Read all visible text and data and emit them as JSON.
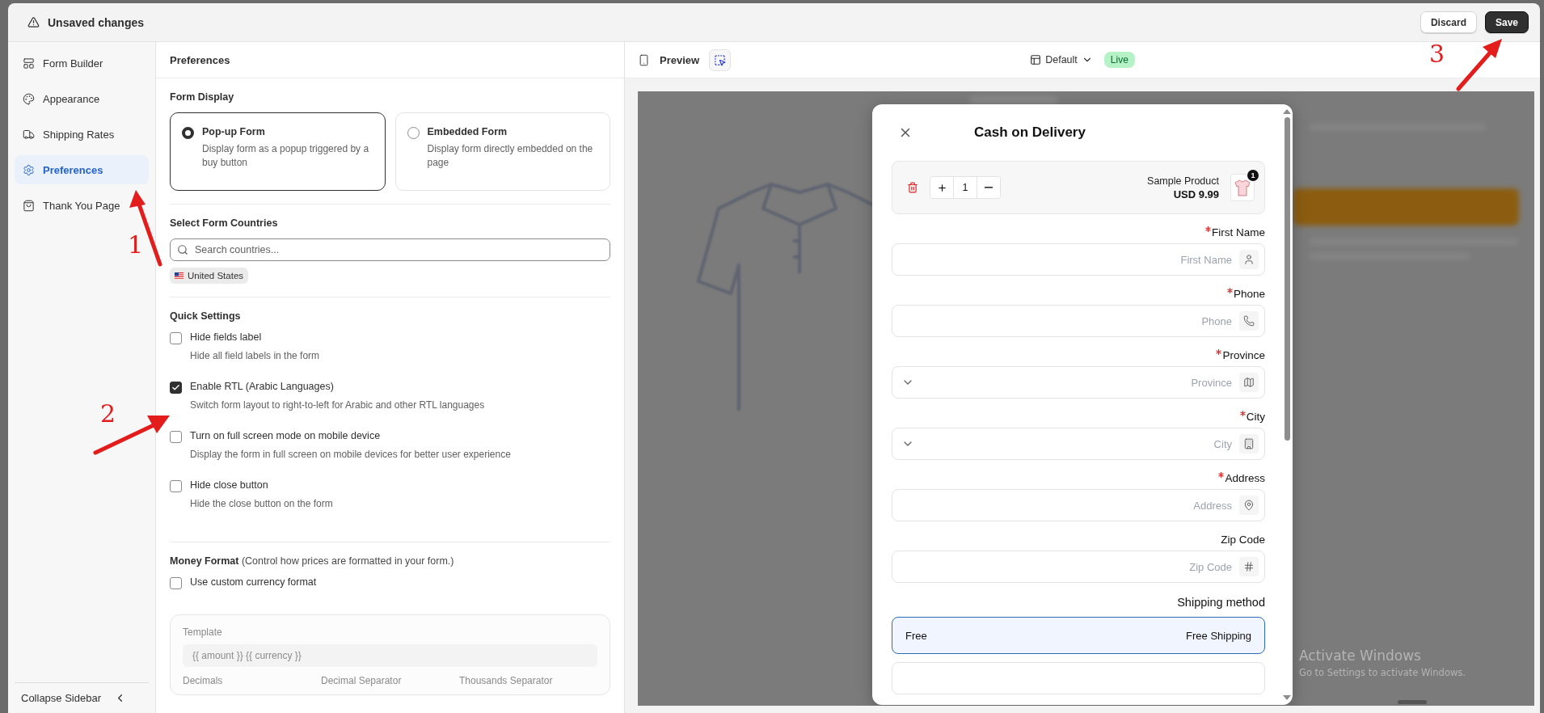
{
  "header": {
    "title": "Unsaved changes",
    "buttons": [
      {
        "label": "Discard",
        "kind": "secondary"
      },
      {
        "label": "Save",
        "kind": "primary"
      }
    ]
  },
  "sidebar": {
    "items": [
      {
        "label": "Form Builder",
        "selected": false
      },
      {
        "label": "Appearance",
        "selected": false
      },
      {
        "label": "Shipping Rates",
        "selected": false
      },
      {
        "label": "Preferences",
        "selected": true
      },
      {
        "label": "Thank You Page",
        "selected": false
      }
    ],
    "collapse_label": "Collapse Sidebar"
  },
  "settings": {
    "title": "Preferences",
    "form_display": {
      "heading": "Form Display",
      "options": [
        {
          "title": "Pop-up Form",
          "description": "Display form as a popup triggered by a buy button",
          "selected": true
        },
        {
          "title": "Embedded Form",
          "description": "Display form directly embedded on the page",
          "selected": false
        }
      ]
    },
    "countries": {
      "heading": "Select Form Countries",
      "search": {
        "placeholder": "Search countries..."
      },
      "chips": [
        {
          "label": "United States"
        }
      ]
    },
    "quick_settings": {
      "heading": "Quick Settings",
      "options": [
        {
          "label": "Hide fields label",
          "description": "Hide all field labels in the form",
          "checked": false
        },
        {
          "label": "Enable RTL (Arabic Languages)",
          "description": "Switch form layout to right-to-left for Arabic and other RTL languages",
          "checked": true
        },
        {
          "label": "Turn on full screen mode on mobile device",
          "description": "Display the form in full screen on mobile devices for better user experience",
          "checked": false
        },
        {
          "label": "Hide close button",
          "description": "Hide the close button on the form",
          "checked": false
        }
      ]
    },
    "money_format": {
      "heading": "**Money Format** (Control how prices are formatted in your form.)",
      "custom_format": {
        "label": "Use custom currency format",
        "checked": false
      },
      "template": {
        "label": "Template",
        "placeholder": "{{ amount }} {{ currency }}",
        "disabled": true
      },
      "columns": [
        "Decimals",
        "Decimal Separator",
        "Thousands Separator"
      ]
    }
  },
  "preview": {
    "title": "Preview",
    "theme": "Default",
    "status": "Live",
    "form": {
      "title": "Cash on Delivery",
      "product": {
        "name": "Sample Product",
        "price": "USD 9.99",
        "quantity": "1",
        "badge": "1"
      },
      "fields": [
        {
          "label": "First Name",
          "placeholder": "First Name",
          "required": true,
          "kind": "text"
        },
        {
          "label": "Phone",
          "placeholder": "Phone",
          "required": true,
          "kind": "text"
        },
        {
          "label": "Province",
          "placeholder": "Province",
          "required": true,
          "kind": "select"
        },
        {
          "label": "City",
          "placeholder": "City",
          "required": true,
          "kind": "select"
        },
        {
          "label": "Address",
          "placeholder": "Address",
          "required": true,
          "kind": "text"
        },
        {
          "label": "Zip Code",
          "placeholder": "Zip Code",
          "required": false,
          "kind": "text"
        }
      ],
      "shipping": {
        "heading": "Shipping method",
        "options": [
          {
            "name": "Free",
            "label": "Free Shipping",
            "selected": true
          }
        ]
      }
    },
    "os_notice": {
      "title": "Activate Windows",
      "text": "Go to Settings to activate Windows."
    }
  },
  "annotations": [
    {
      "label": "1"
    },
    {
      "label": "2"
    },
    {
      "label": "3"
    }
  ]
}
